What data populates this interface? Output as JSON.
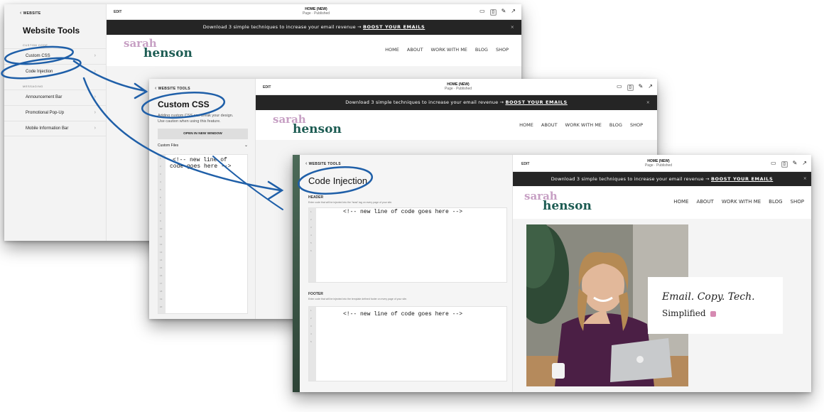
{
  "common": {
    "edit_label": "EDIT",
    "page_name": "HOME (NEW)",
    "page_status": "Page · Published",
    "announcement_text": "Download 3 simple techniques to increase your email revenue →",
    "announcement_link": "BOOST YOUR EMAILS",
    "close_glyph": "×",
    "logo_line1": "sarah",
    "logo_line2": "henson",
    "nav": [
      "HOME",
      "ABOUT",
      "WORK WITH ME",
      "BLOG",
      "SHOP"
    ],
    "back_label": "WEBSITE TOOLS"
  },
  "window1": {
    "panel_title": "Website Tools",
    "custom_code_label": "CUSTOM CODE",
    "custom_code_items": [
      "Custom CSS",
      "Code Injection"
    ],
    "messaging_label": "MESSAGING",
    "messaging_items": [
      "Announcement Bar",
      "Promotional Pop-Up",
      "Mobile Information Bar"
    ]
  },
  "window2": {
    "panel_title": "Custom CSS",
    "warning_line1": "Adding custom CSS can break your design.",
    "warning_line2": "Use caution when using this feature.",
    "open_button": "OPEN IN NEW WINDOW",
    "custom_files_label": "Custom Files",
    "code_line1": "<!-- new line of",
    "code_line2": "code goes here -->"
  },
  "window3": {
    "panel_title": "Code Injection",
    "header_label": "HEADER",
    "header_help": "Enter code that will be injected into the 'head' tag on every page of your site.",
    "header_code": "<!-- new line of code goes here -->",
    "footer_label": "FOOTER",
    "footer_help": "Enter code that will be injected into the template defined footer on every page of your site.",
    "footer_code": "<!-- new line of code goes here -->",
    "hero_title": "Email. Copy. Tech.",
    "hero_subtitle": "Simplified"
  },
  "colors": {
    "logo_pink": "#c7a0c4",
    "logo_teal": "#1d5c53",
    "annotation_blue": "#1f5fa8",
    "announcement_bg": "#252525"
  }
}
